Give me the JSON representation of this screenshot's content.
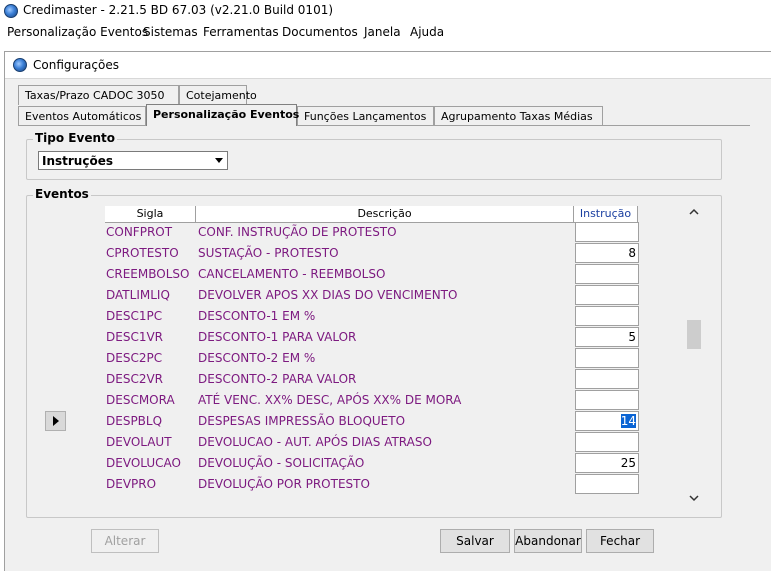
{
  "app": {
    "title": "Credimaster - 2.21.5 BD 67.03 (v2.21.0 Build 0101)"
  },
  "menu": [
    "Personalização Eventos",
    "Sistemas",
    "Ferramentas",
    "Documentos",
    "Janela",
    "Ajuda"
  ],
  "dialog": {
    "title": "Configurações"
  },
  "tabs_row1": [
    "Taxas/Prazo CADOC 3050",
    "Cotejamento"
  ],
  "tabs_row2": [
    "Eventos Automáticos",
    "Personalização Eventos",
    "Funções Lançamentos",
    "Agrupamento Taxas Médias"
  ],
  "active_tab": "Personalização Eventos",
  "tipo_evento": {
    "label": "Tipo Evento",
    "selected": "Instruções"
  },
  "eventos": {
    "label": "Eventos",
    "columns": [
      "Sigla",
      "Descrição",
      "Instrução"
    ],
    "rows": [
      {
        "sigla": "CONFPROT",
        "descricao": "CONF. INSTRUÇÃO DE PROTESTO",
        "instrucao": ""
      },
      {
        "sigla": "CPROTESTO",
        "descricao": "SUSTAÇÃO - PROTESTO",
        "instrucao": "8"
      },
      {
        "sigla": "CREEMBOLSO",
        "descricao": "CANCELAMENTO - REEMBOLSO",
        "instrucao": ""
      },
      {
        "sigla": "DATLIMLIQ",
        "descricao": "DEVOLVER APOS XX DIAS DO VENCIMENTO",
        "instrucao": ""
      },
      {
        "sigla": "DESC1PC",
        "descricao": "DESCONTO-1 EM %",
        "instrucao": ""
      },
      {
        "sigla": "DESC1VR",
        "descricao": "DESCONTO-1 PARA VALOR",
        "instrucao": "5"
      },
      {
        "sigla": "DESC2PC",
        "descricao": "DESCONTO-2 EM %",
        "instrucao": ""
      },
      {
        "sigla": "DESC2VR",
        "descricao": "DESCONTO-2 PARA VALOR",
        "instrucao": ""
      },
      {
        "sigla": "DESCMORA",
        "descricao": "ATÉ VENC. XX% DESC, APÓS XX% DE MORA",
        "instrucao": ""
      },
      {
        "sigla": "DESPBLQ",
        "descricao": "DESPESAS IMPRESSÃO BLOQUETO",
        "instrucao": "14"
      },
      {
        "sigla": "DEVOLAUT",
        "descricao": "DEVOLUCAO - AUT. APÓS DIAS ATRASO",
        "instrucao": ""
      },
      {
        "sigla": "DEVOLUCAO",
        "descricao": "DEVOLUÇÃO - SOLICITAÇÃO",
        "instrucao": "25"
      },
      {
        "sigla": "DEVPRO",
        "descricao": "DEVOLUÇÃO POR PROTESTO",
        "instrucao": ""
      }
    ],
    "current_row": 9
  },
  "buttons": {
    "alterar": "Alterar",
    "salvar": "Salvar",
    "abandonar": "Abandonar",
    "fechar": "Fechar"
  },
  "scroll": {
    "up": "^",
    "down": "v"
  }
}
